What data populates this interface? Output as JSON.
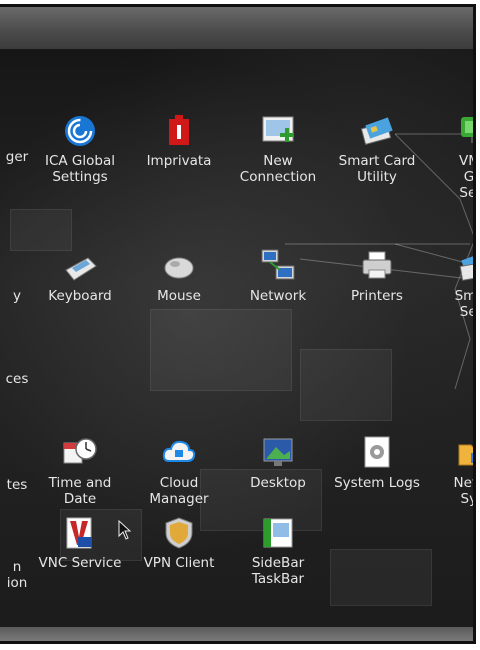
{
  "desktop": {
    "items": [
      {
        "label": "ger",
        "icon": "manager-icon"
      },
      {
        "label": "ICA Global\nSettings",
        "icon": "ica-global-settings-icon"
      },
      {
        "label": "Imprivata",
        "icon": "imprivata-icon"
      },
      {
        "label": "New\nConnection",
        "icon": "new-connection-icon"
      },
      {
        "label": "Smart Card\nUtility",
        "icon": "smart-card-utility-icon"
      },
      {
        "label": "VMw\nGlo\nSetti",
        "icon": "vmware-global-settings-icon"
      },
      {
        "label": "y",
        "icon": "display-icon"
      },
      {
        "label": "Keyboard",
        "icon": "keyboard-icon"
      },
      {
        "label": "Mouse",
        "icon": "mouse-icon"
      },
      {
        "label": "Network",
        "icon": "network-icon"
      },
      {
        "label": "Printers",
        "icon": "printers-icon"
      },
      {
        "label": "Smart\nServ",
        "icon": "smart-services-icon"
      },
      {
        "label": "ces",
        "icon": "devices-icon"
      },
      {
        "label": "tes",
        "icon": "certificates-icon"
      },
      {
        "label": "Time and\nDate",
        "icon": "time-and-date-icon"
      },
      {
        "label": "Cloud\nManager",
        "icon": "cloud-manager-icon"
      },
      {
        "label": "Desktop",
        "icon": "desktop-icon"
      },
      {
        "label": "System Logs",
        "icon": "system-logs-icon"
      },
      {
        "label": "Netwo\nSyst",
        "icon": "network-system-icon"
      },
      {
        "label": "n\nion",
        "icon": "application-icon"
      },
      {
        "label": "VNC Service",
        "icon": "vnc-service-icon"
      },
      {
        "label": "VPN Client",
        "icon": "vpn-client-icon"
      },
      {
        "label": "SideBar\nTaskBar",
        "icon": "sidebar-taskbar-icon"
      }
    ]
  }
}
